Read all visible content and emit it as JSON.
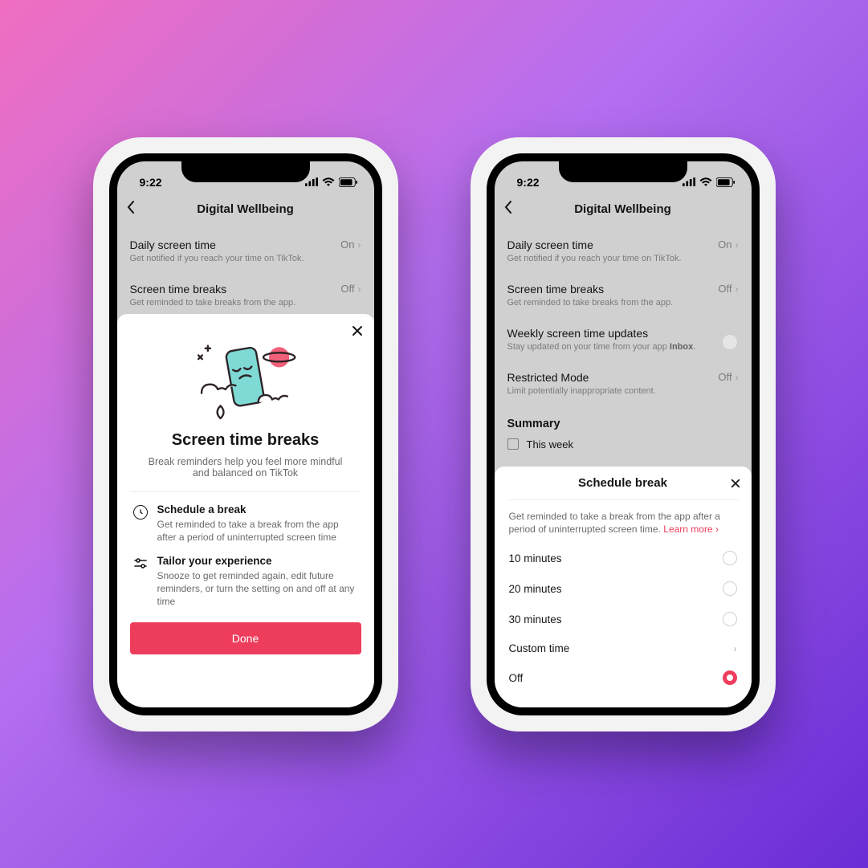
{
  "status": {
    "time": "9:22"
  },
  "header": {
    "title": "Digital Wellbeing"
  },
  "settings": [
    {
      "title": "Daily screen time",
      "value": "On",
      "desc": "Get notified if you reach your time on TikTok."
    },
    {
      "title": "Screen time breaks",
      "value": "Off",
      "desc": "Get reminded to take breaks from the app."
    },
    {
      "title": "Weekly screen time updates",
      "desc_prefix": "Stay updated on your time from your app ",
      "desc_link": "Inbox",
      "desc_suffix": "."
    },
    {
      "title": "Restricted Mode",
      "value": "Off",
      "desc": "Limit potentially inappropriate content."
    }
  ],
  "summary": {
    "heading": "Summary",
    "period": "This week"
  },
  "left_sheet": {
    "title": "Screen time breaks",
    "subtitle": "Break reminders help you feel more mindful and balanced on TikTok",
    "features": [
      {
        "title": "Schedule a break",
        "desc": "Get reminded to take a break from the app after a period of uninterrupted screen time"
      },
      {
        "title": "Tailor your experience",
        "desc": "Snooze to get reminded again, edit future reminders, or turn the setting on and off at any time"
      }
    ],
    "button": "Done"
  },
  "right_sheet": {
    "title": "Schedule break",
    "desc": "Get reminded to take a break from the app after a period of uninterrupted screen time. ",
    "learn_more": "Learn more",
    "options": [
      {
        "label": "10 minutes",
        "selected": false
      },
      {
        "label": "20 minutes",
        "selected": false
      },
      {
        "label": "30 minutes",
        "selected": false
      }
    ],
    "custom": "Custom time",
    "off": "Off"
  }
}
